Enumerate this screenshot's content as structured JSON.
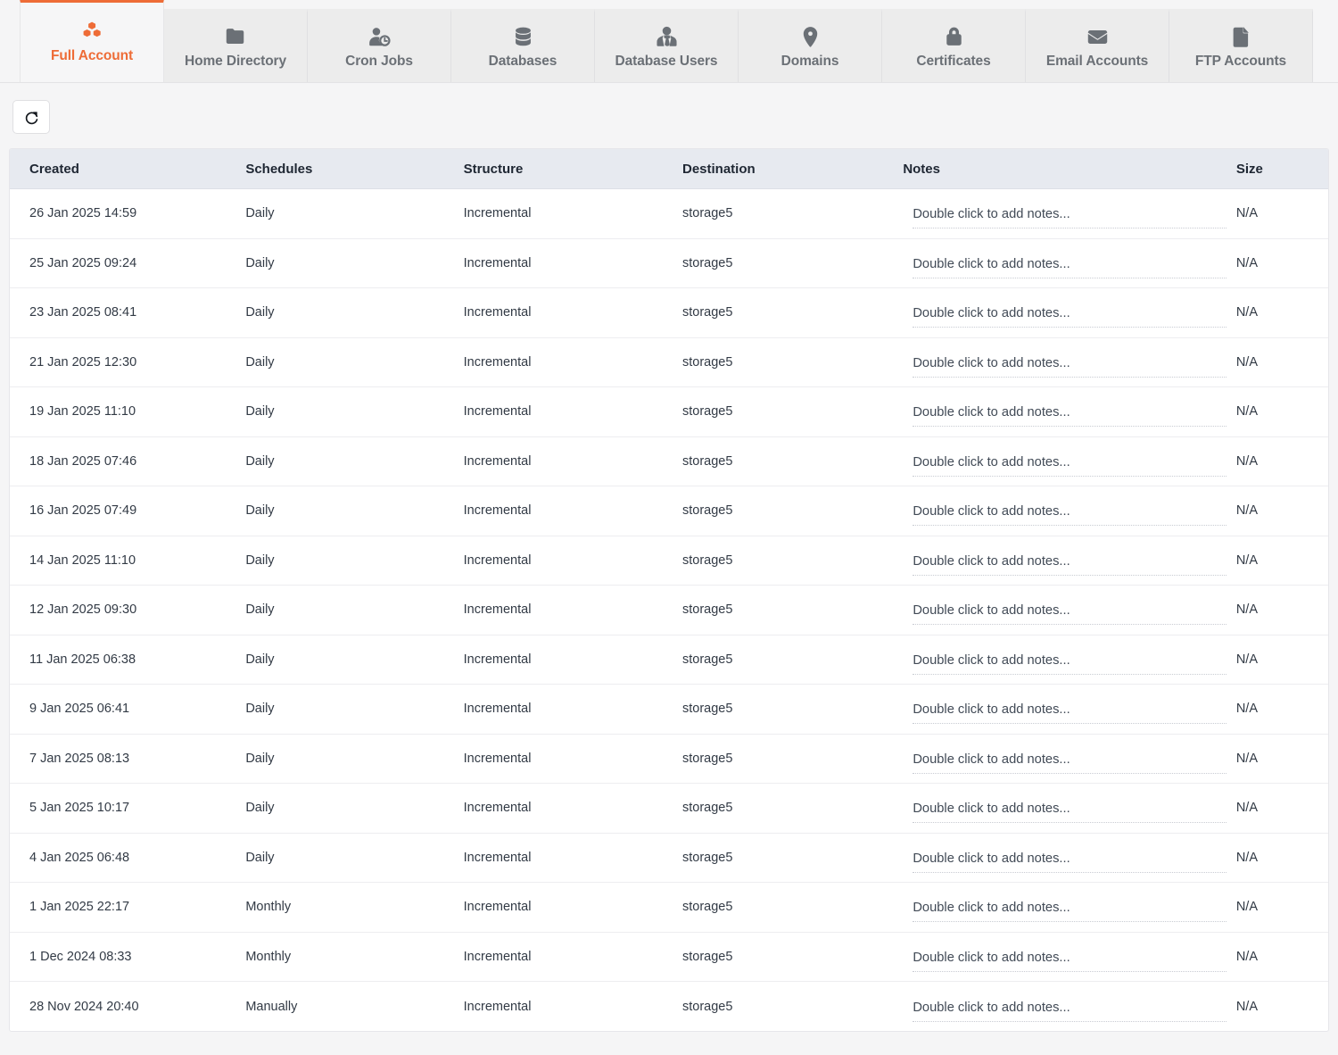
{
  "tabs": [
    {
      "label": "Full Account",
      "icon": "boxes-icon",
      "active": true
    },
    {
      "label": "Home Directory",
      "icon": "folder-icon",
      "active": false
    },
    {
      "label": "Cron Jobs",
      "icon": "user-clock-icon",
      "active": false
    },
    {
      "label": "Databases",
      "icon": "database-icon",
      "active": false
    },
    {
      "label": "Database Users",
      "icon": "user-tie-icon",
      "active": false
    },
    {
      "label": "Domains",
      "icon": "map-marker-icon",
      "active": false
    },
    {
      "label": "Certificates",
      "icon": "lock-icon",
      "active": false
    },
    {
      "label": "Email Accounts",
      "icon": "envelope-icon",
      "active": false
    },
    {
      "label": "FTP Accounts",
      "icon": "file-icon",
      "active": false
    }
  ],
  "toolbar": {
    "refresh_icon": "refresh-icon",
    "refresh_title": "Refresh"
  },
  "table": {
    "columns": [
      "Created",
      "Schedules",
      "Structure",
      "Destination",
      "Notes",
      "Size"
    ],
    "notes_placeholder": "Double click to add notes...",
    "rows": [
      {
        "created": "26 Jan 2025 14:59",
        "schedule": "Daily",
        "structure": "Incremental",
        "destination": "storage5",
        "notes": "",
        "size": "N/A"
      },
      {
        "created": "25 Jan 2025 09:24",
        "schedule": "Daily",
        "structure": "Incremental",
        "destination": "storage5",
        "notes": "",
        "size": "N/A"
      },
      {
        "created": "23 Jan 2025 08:41",
        "schedule": "Daily",
        "structure": "Incremental",
        "destination": "storage5",
        "notes": "",
        "size": "N/A"
      },
      {
        "created": "21 Jan 2025 12:30",
        "schedule": "Daily",
        "structure": "Incremental",
        "destination": "storage5",
        "notes": "",
        "size": "N/A"
      },
      {
        "created": "19 Jan 2025 11:10",
        "schedule": "Daily",
        "structure": "Incremental",
        "destination": "storage5",
        "notes": "",
        "size": "N/A"
      },
      {
        "created": "18 Jan 2025 07:46",
        "schedule": "Daily",
        "structure": "Incremental",
        "destination": "storage5",
        "notes": "",
        "size": "N/A"
      },
      {
        "created": "16 Jan 2025 07:49",
        "schedule": "Daily",
        "structure": "Incremental",
        "destination": "storage5",
        "notes": "",
        "size": "N/A"
      },
      {
        "created": "14 Jan 2025 11:10",
        "schedule": "Daily",
        "structure": "Incremental",
        "destination": "storage5",
        "notes": "",
        "size": "N/A"
      },
      {
        "created": "12 Jan 2025 09:30",
        "schedule": "Daily",
        "structure": "Incremental",
        "destination": "storage5",
        "notes": "",
        "size": "N/A"
      },
      {
        "created": "11 Jan 2025 06:38",
        "schedule": "Daily",
        "structure": "Incremental",
        "destination": "storage5",
        "notes": "",
        "size": "N/A"
      },
      {
        "created": "9 Jan 2025 06:41",
        "schedule": "Daily",
        "structure": "Incremental",
        "destination": "storage5",
        "notes": "",
        "size": "N/A"
      },
      {
        "created": "7 Jan 2025 08:13",
        "schedule": "Daily",
        "structure": "Incremental",
        "destination": "storage5",
        "notes": "",
        "size": "N/A"
      },
      {
        "created": "5 Jan 2025 10:17",
        "schedule": "Daily",
        "structure": "Incremental",
        "destination": "storage5",
        "notes": "",
        "size": "N/A"
      },
      {
        "created": "4 Jan 2025 06:48",
        "schedule": "Daily",
        "structure": "Incremental",
        "destination": "storage5",
        "notes": "",
        "size": "N/A"
      },
      {
        "created": "1 Jan 2025 22:17",
        "schedule": "Monthly",
        "structure": "Incremental",
        "destination": "storage5",
        "notes": "",
        "size": "N/A"
      },
      {
        "created": "1 Dec 2024 08:33",
        "schedule": "Monthly",
        "structure": "Incremental",
        "destination": "storage5",
        "notes": "",
        "size": "N/A"
      },
      {
        "created": "28 Nov 2024 20:40",
        "schedule": "Manually",
        "structure": "Incremental",
        "destination": "storage5",
        "notes": "",
        "size": "N/A"
      }
    ]
  },
  "colors": {
    "accent": "#ee6c37",
    "tab_inactive_text": "#6b7076",
    "header_bg": "#e7eaf0",
    "page_bg": "#f5f5f6"
  }
}
